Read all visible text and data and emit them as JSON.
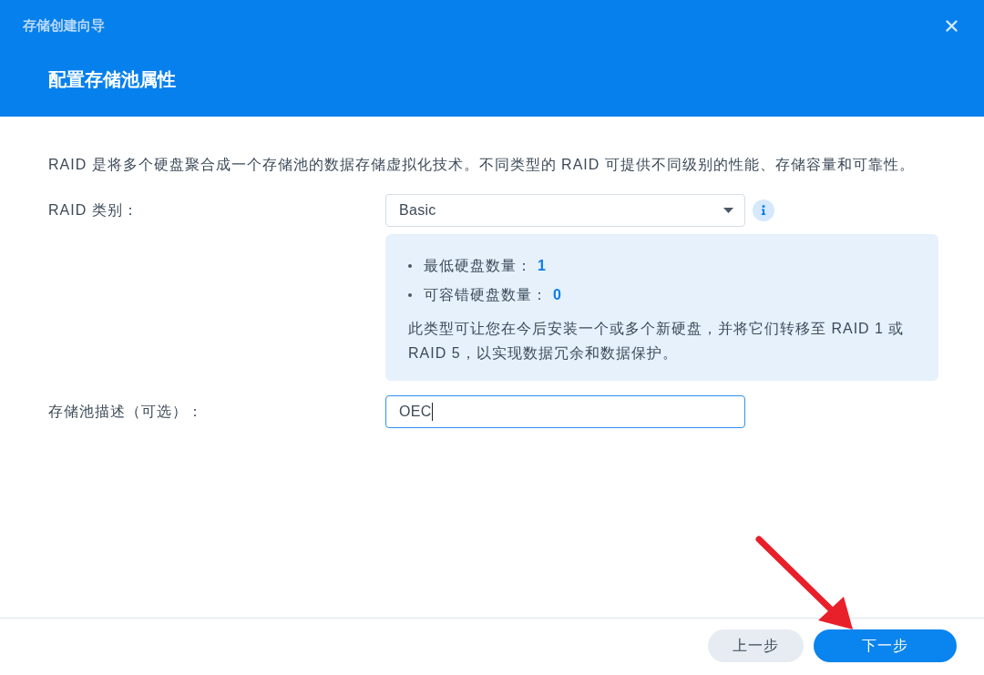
{
  "window": {
    "title": "存储创建向导"
  },
  "header": {
    "heading": "配置存储池属性"
  },
  "intro": "RAID 是将多个硬盘聚合成一个存储池的数据存储虚拟化技术。不同类型的 RAID 可提供不同级别的性能、存储容量和可靠性。",
  "raid_type": {
    "label": "RAID 类别：",
    "value": "Basic"
  },
  "raid_info": {
    "facts": [
      {
        "label": "最低硬盘数量：",
        "value": "1"
      },
      {
        "label": "可容错硬盘数量：",
        "value": "0"
      }
    ],
    "note": "此类型可让您在今后安装一个或多个新硬盘，并将它们转移至 RAID 1 或 RAID 5，以实现数据冗余和数据保护。"
  },
  "description": {
    "label": "存储池描述（可选）：",
    "value": "OEC",
    "focused": true
  },
  "buttons": [
    {
      "label": "上一步",
      "kind": "secondary"
    },
    {
      "label": "下一步",
      "kind": "primary"
    }
  ]
}
